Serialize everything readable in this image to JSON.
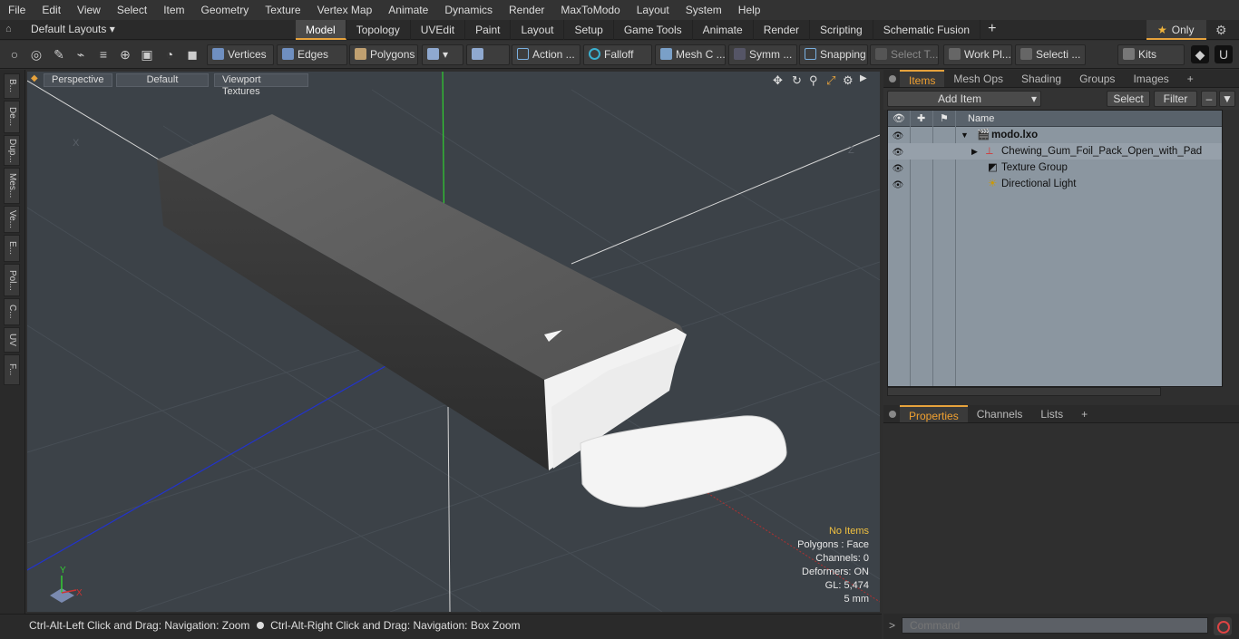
{
  "menu": [
    "File",
    "Edit",
    "View",
    "Select",
    "Item",
    "Geometry",
    "Texture",
    "Vertex Map",
    "Animate",
    "Dynamics",
    "Render",
    "MaxToModo",
    "Layout",
    "System",
    "Help"
  ],
  "layouts_label": "Default Layouts ▾",
  "top_tabs": [
    {
      "label": "Model",
      "active": true
    },
    {
      "label": "Topology"
    },
    {
      "label": "UVEdit"
    },
    {
      "label": "Paint"
    },
    {
      "label": "Layout"
    },
    {
      "label": "Setup"
    },
    {
      "label": "Game Tools"
    },
    {
      "label": "Animate"
    },
    {
      "label": "Render"
    },
    {
      "label": "Scripting"
    },
    {
      "label": "Schematic Fusion"
    }
  ],
  "only_label": "Only",
  "toolbar": {
    "vertices": "Vertices",
    "edges": "Edges",
    "polygons": "Polygons",
    "action": "Action ...",
    "falloff": "Falloff",
    "meshc": "Mesh C ...",
    "symm": "Symm ...",
    "snapping": "Snapping",
    "selectt": "Select T...",
    "workpl": "Work Pl...",
    "selecti": "Selecti ...",
    "kits": "Kits"
  },
  "left_tabs": [
    "B...",
    "De...",
    "Dup...",
    "Mes...",
    "Ve...",
    "E...",
    "Pol...",
    "C...",
    "UV",
    "F..."
  ],
  "viewport": {
    "camera": "Perspective",
    "shading": "Default",
    "textures": "Viewport Textures",
    "info": {
      "items": "No Items",
      "polygons": "Polygons : Face",
      "channels": "Channels: 0",
      "deformers": "Deformers: ON",
      "gl": "GL: 5,474",
      "size": "5 mm"
    },
    "axis_labels": {
      "y": "Y",
      "x": "X"
    }
  },
  "status_left": "Ctrl-Alt-Left Click and Drag: Navigation: Zoom",
  "status_right": "Ctrl-Alt-Right Click and Drag: Navigation: Box Zoom",
  "panel_tabs_top": [
    "Items",
    "Mesh Ops",
    "Shading",
    "Groups",
    "Images"
  ],
  "items_tools": {
    "add_item": "Add Item",
    "select": "Select",
    "filter": "Filter"
  },
  "tree": {
    "name_header": "Name",
    "rows": [
      {
        "label": "modo.lxo",
        "bold": true
      },
      {
        "label": "Chewing_Gum_Foil_Pack_Open_with_Pad"
      },
      {
        "label": "Texture Group"
      },
      {
        "label": "Directional Light"
      }
    ]
  },
  "panel_tabs_bottom": [
    "Properties",
    "Channels",
    "Lists"
  ],
  "command_placeholder": "Command"
}
